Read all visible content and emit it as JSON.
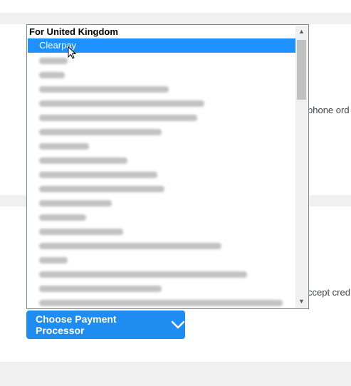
{
  "background_text": {
    "right_text_1": "phone ord",
    "right_text_2": "ccept cred"
  },
  "dropdown": {
    "group_label": "For United Kingdom",
    "options": [
      {
        "label": "Clearpay",
        "selected": true
      },
      {
        "label": "",
        "selected": false
      },
      {
        "label": "",
        "selected": false
      },
      {
        "label": "",
        "selected": false
      },
      {
        "label": "",
        "selected": false
      },
      {
        "label": "",
        "selected": false
      },
      {
        "label": "",
        "selected": false
      },
      {
        "label": "",
        "selected": false
      },
      {
        "label": "",
        "selected": false
      },
      {
        "label": "",
        "selected": false
      },
      {
        "label": "",
        "selected": false
      },
      {
        "label": "",
        "selected": false
      },
      {
        "label": "",
        "selected": false
      },
      {
        "label": "",
        "selected": false
      },
      {
        "label": "",
        "selected": false
      },
      {
        "label": "",
        "selected": false
      },
      {
        "label": "",
        "selected": false
      },
      {
        "label": "",
        "selected": false
      },
      {
        "label": "",
        "selected": false
      }
    ],
    "scroll_up_icon": "triangle-up",
    "scroll_down_icon": "triangle-down"
  },
  "choose_button": {
    "label": "Choose Payment Processor",
    "icon": "chevron-down"
  },
  "colors": {
    "accent": "#1e8cf0",
    "selected_option": "#1e90ff"
  }
}
